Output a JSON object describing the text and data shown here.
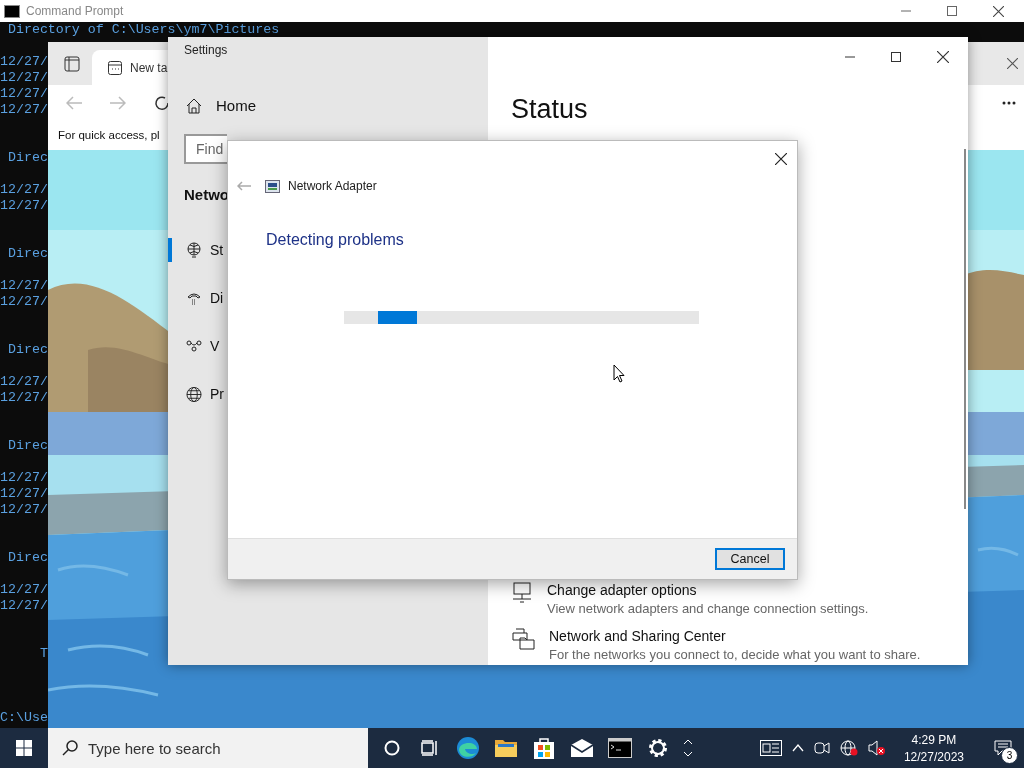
{
  "cmd": {
    "title": "Command Prompt",
    "groups": [
      {
        "heading": "Directory of C:\\Users\\ym7\\Pictures",
        "entries": [
          "12/27/",
          "12/27/",
          "12/27/",
          "12/27/"
        ]
      },
      {
        "heading": "Direc",
        "entries": [
          "12/27/",
          "12/27/"
        ]
      },
      {
        "heading": "Direc",
        "entries": [
          "12/27/",
          "12/27/"
        ]
      },
      {
        "heading": "Direc",
        "entries": [
          "12/27/",
          "12/27/"
        ]
      },
      {
        "heading": "Direc",
        "entries": [
          "12/27/",
          "12/27/",
          "12/27/"
        ]
      },
      {
        "heading": "Direc",
        "entries": [
          "12/27/",
          "12/27/"
        ]
      }
    ],
    "summary": "T",
    "prompt": "C:\\Use"
  },
  "browser": {
    "tab": "New ta",
    "notice": "For quick access, pl"
  },
  "settings": {
    "title": "Settings",
    "home": "Home",
    "search": {
      "placeholder": "Find"
    },
    "section": "Netwo",
    "nav": [
      {
        "kind": "status",
        "label": "St",
        "selected": true
      },
      {
        "kind": "dialup",
        "label": "Di",
        "selected": false
      },
      {
        "kind": "vpn",
        "label": "V",
        "selected": false
      },
      {
        "kind": "proxy",
        "label": "Pr",
        "selected": false
      }
    ],
    "page_title": "Status",
    "links": [
      {
        "kind": "adapter",
        "title": "Change adapter options",
        "description": "View network adapters and change connection settings."
      },
      {
        "kind": "sharing",
        "title": "Network and Sharing Center",
        "description": "For the networks you connect to, decide what you want to share."
      }
    ]
  },
  "dialog": {
    "title": "Network Adapter",
    "heading": "Detecting problems",
    "progress": {
      "level": 0.11
    },
    "button": "Cancel"
  },
  "taskbar": {
    "search": {
      "placeholder": "Type here to search"
    },
    "apps": [
      {
        "kind": "cortana"
      },
      {
        "kind": "taskview"
      },
      {
        "kind": "edge"
      },
      {
        "kind": "explorer"
      },
      {
        "kind": "store"
      },
      {
        "kind": "mail"
      },
      {
        "kind": "terminal"
      },
      {
        "kind": "settings"
      }
    ],
    "time": "4:29 PM",
    "date": "12/27/2023",
    "notifications": "3"
  }
}
